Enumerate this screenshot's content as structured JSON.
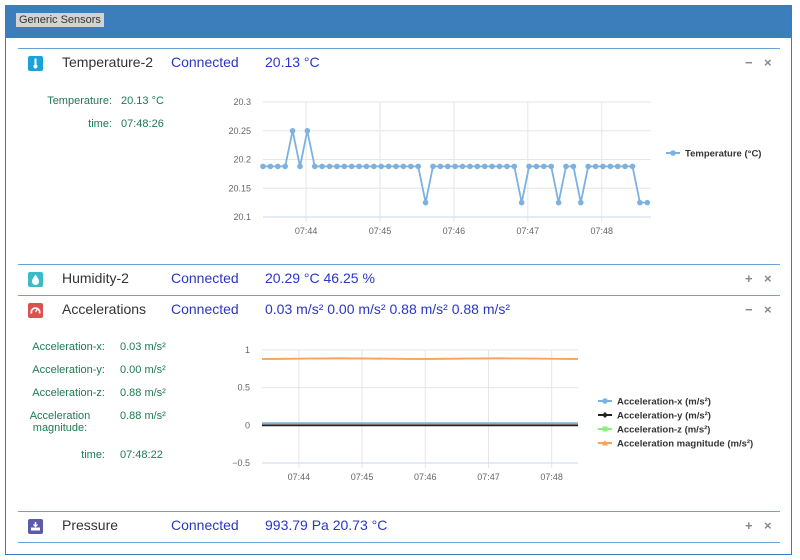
{
  "header": {
    "title": "Generic Sensors"
  },
  "colors": {
    "accent": "#3c7dbc",
    "status": "#2b36c5",
    "kv": "#1d7a53"
  },
  "panels": {
    "temperature": {
      "title": "Temperature-2",
      "status": "Connected",
      "value": "20.13 °C",
      "icon": "thermometer-icon",
      "icon_color": "#1aa3d9",
      "collapse": "−",
      "close": "×",
      "details": [
        {
          "label": "Temperature:",
          "value": "20.13 °C"
        },
        {
          "label": "time:",
          "value": "07:48:26"
        }
      ]
    },
    "humidity": {
      "title": "Humidity-2",
      "status": "Connected",
      "value": "20.29 °C  46.25 %",
      "icon": "droplet-icon",
      "icon_color": "#3bbbc8",
      "expand": "+",
      "close": "×"
    },
    "accel": {
      "title": "Accelerations",
      "status": "Connected",
      "value": "0.03 m/s²  0.00 m/s²  0.88 m/s²  0.88 m/s²",
      "icon": "gauge-icon",
      "icon_color": "#d9534f",
      "collapse": "−",
      "close": "×",
      "details": [
        {
          "label": "Acceleration-x:",
          "value": "0.03 m/s²"
        },
        {
          "label": "Acceleration-y:",
          "value": "0.00 m/s²"
        },
        {
          "label": "Acceleration-z:",
          "value": "0.88 m/s²"
        },
        {
          "label": "Acceleration magnitude:",
          "label1": "Acceleration",
          "label2": "magnitude:",
          "value": "0.88 m/s²"
        },
        {
          "label": "time:",
          "value": "07:48:22"
        }
      ]
    },
    "pressure": {
      "title": "Pressure",
      "status": "Connected",
      "value": "993.79 Pa  20.73 °C",
      "icon": "pressure-icon",
      "icon_color": "#5b5ba8",
      "expand": "+",
      "close": "×"
    }
  },
  "chart_data": [
    {
      "type": "line",
      "title": "",
      "x_ticks": [
        "07:44",
        "07:45",
        "07:46",
        "07:47",
        "07:48"
      ],
      "xlim": [
        "07:43:25",
        "07:48:40"
      ],
      "y_ticks": [
        "20.3",
        "20.25",
        "20.2",
        "20.15",
        "20.1"
      ],
      "ylim": [
        20.1,
        20.3
      ],
      "legend_position": "right",
      "series": [
        {
          "name": "Temperature (°C)",
          "color": "#7cb1e0",
          "marker": "circle",
          "x": [
            "07:43:25",
            "07:43:31",
            "07:43:37",
            "07:43:43",
            "07:43:49",
            "07:43:55",
            "07:44:01",
            "07:44:07",
            "07:44:13",
            "07:44:19",
            "07:44:25",
            "07:44:31",
            "07:44:37",
            "07:44:43",
            "07:44:49",
            "07:44:55",
            "07:45:01",
            "07:45:07",
            "07:45:13",
            "07:45:19",
            "07:45:25",
            "07:45:31",
            "07:45:37",
            "07:45:43",
            "07:45:49",
            "07:45:55",
            "07:46:01",
            "07:46:07",
            "07:46:13",
            "07:46:19",
            "07:46:25",
            "07:46:31",
            "07:46:37",
            "07:46:43",
            "07:46:49",
            "07:46:55",
            "07:47:01",
            "07:47:07",
            "07:47:13",
            "07:47:19",
            "07:47:25",
            "07:47:31",
            "07:47:37",
            "07:47:43",
            "07:47:49",
            "07:47:55",
            "07:48:01",
            "07:48:07",
            "07:48:13",
            "07:48:19",
            "07:48:25",
            "07:48:31",
            "07:48:37"
          ],
          "y": [
            20.188,
            20.188,
            20.188,
            20.188,
            20.25,
            20.188,
            20.25,
            20.188,
            20.188,
            20.188,
            20.188,
            20.188,
            20.188,
            20.188,
            20.188,
            20.188,
            20.188,
            20.188,
            20.188,
            20.188,
            20.188,
            20.188,
            20.125,
            20.188,
            20.188,
            20.188,
            20.188,
            20.188,
            20.188,
            20.188,
            20.188,
            20.188,
            20.188,
            20.188,
            20.188,
            20.125,
            20.188,
            20.188,
            20.188,
            20.188,
            20.125,
            20.188,
            20.188,
            20.125,
            20.188,
            20.188,
            20.188,
            20.188,
            20.188,
            20.188,
            20.188,
            20.125,
            20.125
          ]
        }
      ]
    },
    {
      "type": "line",
      "title": "",
      "x_ticks": [
        "07:44",
        "07:45",
        "07:46",
        "07:47",
        "07:48"
      ],
      "xlim": [
        "07:43:25",
        "07:48:25"
      ],
      "y_ticks": [
        "1",
        "0.5",
        "0",
        "−0.5"
      ],
      "ylim": [
        -0.5,
        1
      ],
      "legend_position": "right",
      "series": [
        {
          "name": "Acceleration-x (m/s²)",
          "color": "#7cb1e0",
          "marker": "circle",
          "x": [
            "07:43:25",
            "07:44:40",
            "07:45:55",
            "07:47:10",
            "07:48:25"
          ],
          "y": [
            0.03,
            0.03,
            0.03,
            0.03,
            0.03
          ]
        },
        {
          "name": "Acceleration-y (m/s²)",
          "color": "#222222",
          "marker": "diamond",
          "x": [
            "07:43:25",
            "07:44:40",
            "07:45:55",
            "07:47:10",
            "07:48:25"
          ],
          "y": [
            0.0,
            0.0,
            0.0,
            0.0,
            0.0
          ]
        },
        {
          "name": "Acceleration-z (m/s²)",
          "color": "#90ee7e",
          "marker": "square",
          "x": [
            "07:43:25",
            "07:44:40",
            "07:45:55",
            "07:47:10",
            "07:48:25"
          ],
          "y": [
            0.88,
            0.89,
            0.88,
            0.89,
            0.88
          ]
        },
        {
          "name": "Acceleration magnitude (m/s²)",
          "color": "#f7a35c",
          "marker": "triangle",
          "x": [
            "07:43:25",
            "07:44:40",
            "07:45:55",
            "07:47:10",
            "07:48:25"
          ],
          "y": [
            0.88,
            0.89,
            0.88,
            0.89,
            0.88
          ]
        }
      ]
    }
  ]
}
